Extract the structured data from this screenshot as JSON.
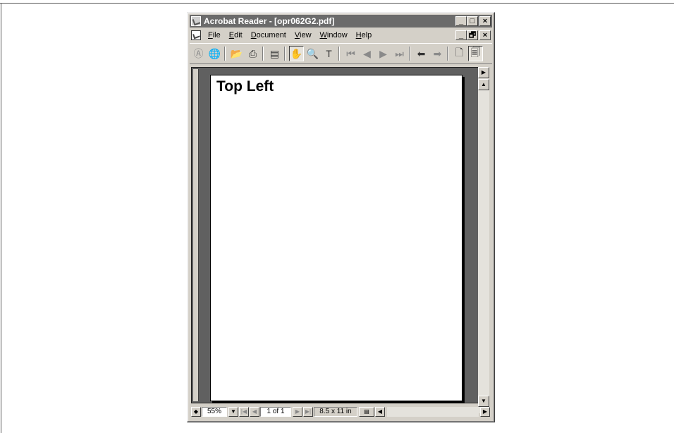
{
  "window": {
    "title": "Acrobat Reader - [opr062G2.pdf]",
    "caption_buttons": [
      "_",
      "□",
      "×"
    ],
    "mdi_buttons": [
      "_",
      "🗗",
      "×"
    ]
  },
  "menubar": {
    "items": [
      {
        "accel": "F",
        "rest": "ile"
      },
      {
        "accel": "E",
        "rest": "dit"
      },
      {
        "accel": "D",
        "rest": "ocument"
      },
      {
        "accel": "V",
        "rest": "iew"
      },
      {
        "accel": "W",
        "rest": "indow"
      },
      {
        "accel": "H",
        "rest": "elp"
      }
    ]
  },
  "toolbar": {
    "icons": [
      "acrobat-logo-icon",
      "web-globe-icon",
      "open-folder-icon",
      "print-icon",
      "show-navigation-pane-icon",
      "hand-tool-icon",
      "zoom-tool-icon",
      "text-select-tool-icon",
      "first-page-icon",
      "previous-page-icon",
      "next-page-icon",
      "last-page-icon",
      "go-back-icon",
      "go-forward-icon",
      "actual-size-icon",
      "fit-page-icon"
    ],
    "glyphs": {
      "acrobat_logo": "Ⓐ",
      "globe": "🌐",
      "open": "📂",
      "print": "⎙",
      "nav_pane": "▤",
      "hand": "✋",
      "zoom": "🔍",
      "text": "T",
      "first": "⏮",
      "prev": "◀",
      "next": "▶",
      "last": "⏭",
      "back": "⬅",
      "forward": "➡",
      "actual": "🗋",
      "fit": "🗐"
    }
  },
  "document": {
    "page_text": "Top Left"
  },
  "statusbar": {
    "zoom": "55%",
    "page": "1 of 1",
    "page_size": "8.5 x 11 in"
  }
}
